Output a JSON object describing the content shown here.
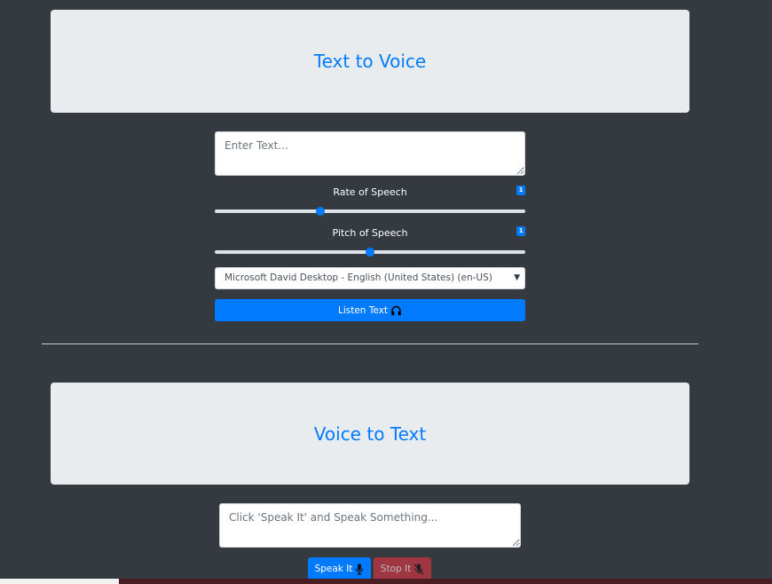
{
  "text_to_voice": {
    "title": "Text to Voice",
    "textarea_placeholder": "Enter Text...",
    "rate": {
      "label": "Rate of Speech",
      "badge": "1",
      "value_fraction": 0.34
    },
    "pitch": {
      "label": "Pitch of Speech",
      "badge": "1",
      "value_fraction": 0.5
    },
    "voice_select": {
      "selected": "Microsoft David Desktop - English (United States) (en-US)"
    },
    "listen_button": "Listen Text"
  },
  "voice_to_text": {
    "title": "Voice to Text",
    "textarea_placeholder": "Click 'Speak It' and Speak Something...",
    "speak_button": "Speak It",
    "stop_button": "Stop It"
  },
  "icons": {
    "listen": "headphones-icon",
    "speak": "microphone-icon",
    "stop": "microphone-slash-icon"
  },
  "colors": {
    "background": "#343a40",
    "jumbotron": "#e9ecef",
    "primary": "#007bff",
    "danger": "#dc3545"
  }
}
